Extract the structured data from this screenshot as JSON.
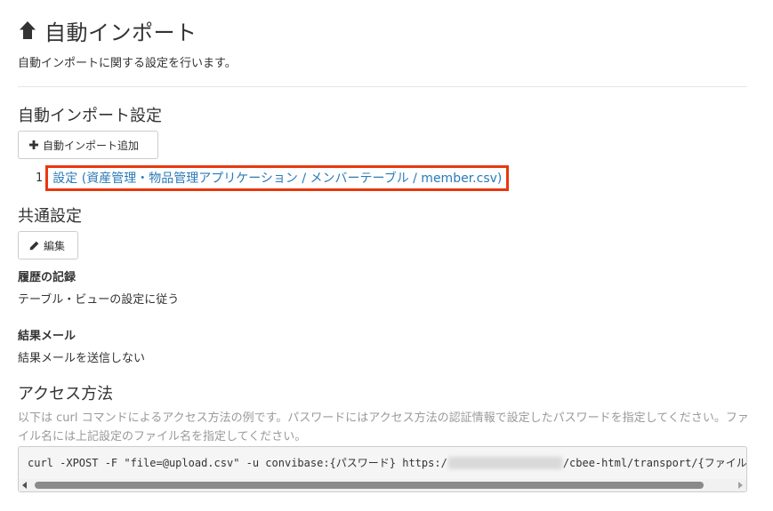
{
  "header": {
    "title": "自動インポート",
    "description": "自動インポートに関する設定を行います。"
  },
  "auto_import": {
    "heading": "自動インポート設定",
    "add_button_label": "自動インポート追加",
    "items": [
      {
        "number": "1",
        "label": "設定 (資産管理・物品管理アプリケーション / メンバーテーブル / member.csv)"
      }
    ]
  },
  "common": {
    "heading": "共通設定",
    "edit_button_label": "編集",
    "history_label": "履歴の記録",
    "history_value": "テーブル・ビューの設定に従う",
    "result_mail_label": "結果メール",
    "result_mail_value": "結果メールを送信しない"
  },
  "access": {
    "heading": "アクセス方法",
    "help_text": "以下は curl コマンドによるアクセス方法の例です。パスワードにはアクセス方法の認証情報で設定したパスワードを指定してください。ファイル名には上記設定のファイル名を指定してください。",
    "command_prefix": "curl -XPOST -F \"file=@upload.csv\" -u convibase:{パスワード} https:/",
    "command_suffix": "/cbee-html/transport/{ファイル"
  },
  "icons": {
    "title_icon": "arrow-up-icon",
    "add_icon": "plus-icon",
    "edit_icon": "pencil-icon"
  },
  "colors": {
    "link": "#2a7ab8",
    "highlight_border": "#e8380d",
    "muted_text": "#9a9a9a"
  }
}
